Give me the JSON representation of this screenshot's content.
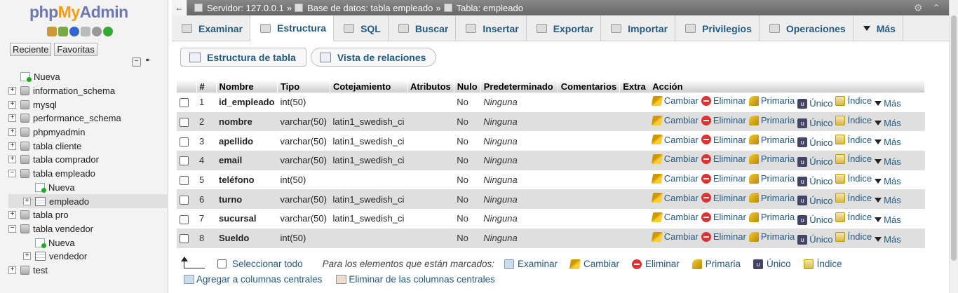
{
  "nav": {
    "logo_php": "php",
    "logo_my": "My",
    "logo_admin": "Admin",
    "tab_recent": "Reciente",
    "tab_favorites": "Favoritas",
    "tree": [
      {
        "label": "Nueva",
        "level": 0,
        "type": "new"
      },
      {
        "label": "information_schema",
        "level": 0,
        "type": "db"
      },
      {
        "label": "mysql",
        "level": 0,
        "type": "db"
      },
      {
        "label": "performance_schema",
        "level": 0,
        "type": "db"
      },
      {
        "label": "phpmyadmin",
        "level": 0,
        "type": "db"
      },
      {
        "label": "tabla cliente",
        "level": 0,
        "type": "db"
      },
      {
        "label": "tabla comprador",
        "level": 0,
        "type": "db"
      },
      {
        "label": "tabla empleado",
        "level": 0,
        "type": "db-open"
      },
      {
        "label": "Nueva",
        "level": 1,
        "type": "new"
      },
      {
        "label": "empleado",
        "level": 1,
        "type": "table"
      },
      {
        "label": "tabla pro",
        "level": 0,
        "type": "db"
      },
      {
        "label": "tabla vendedor",
        "level": 0,
        "type": "db-open"
      },
      {
        "label": "Nueva",
        "level": 1,
        "type": "new"
      },
      {
        "label": "vendedor",
        "level": 1,
        "type": "table"
      },
      {
        "label": "test",
        "level": 0,
        "type": "db"
      }
    ]
  },
  "breadcrumb": {
    "server": "Servidor: 127.0.0.1",
    "database": "Base de datos: tabla empleado",
    "table": "Tabla: empleado",
    "sep": "»"
  },
  "tabs": [
    {
      "label": "Examinar",
      "active": false
    },
    {
      "label": "Estructura",
      "active": true
    },
    {
      "label": "SQL",
      "active": false
    },
    {
      "label": "Buscar",
      "active": false
    },
    {
      "label": "Insertar",
      "active": false
    },
    {
      "label": "Exportar",
      "active": false
    },
    {
      "label": "Importar",
      "active": false
    },
    {
      "label": "Privilegios",
      "active": false
    },
    {
      "label": "Operaciones",
      "active": false
    },
    {
      "label": "Más",
      "active": false
    }
  ],
  "subbuttons": {
    "structure": "Estructura de tabla",
    "relations": "Vista de relaciones"
  },
  "table": {
    "headers": [
      "#",
      "Nombre",
      "Tipo",
      "Cotejamiento",
      "Atributos",
      "Nulo",
      "Predeterminado",
      "Comentarios",
      "Extra",
      "Acción"
    ],
    "rows": [
      {
        "num": "1",
        "name": "id_empleado",
        "type": "int(50)",
        "collation": "",
        "null": "No",
        "default": "Ninguna"
      },
      {
        "num": "2",
        "name": "nombre",
        "type": "varchar(50)",
        "collation": "latin1_swedish_ci",
        "null": "No",
        "default": "Ninguna"
      },
      {
        "num": "3",
        "name": "apellido",
        "type": "varchar(50)",
        "collation": "latin1_swedish_ci",
        "null": "No",
        "default": "Ninguna"
      },
      {
        "num": "4",
        "name": "email",
        "type": "varchar(50)",
        "collation": "latin1_swedish_ci",
        "null": "No",
        "default": "Ninguna"
      },
      {
        "num": "5",
        "name": "teléfono",
        "type": "int(50)",
        "collation": "",
        "null": "No",
        "default": "Ninguna"
      },
      {
        "num": "6",
        "name": "turno",
        "type": "varchar(50)",
        "collation": "latin1_swedish_ci",
        "null": "No",
        "default": "Ninguna"
      },
      {
        "num": "7",
        "name": "sucursal",
        "type": "varchar(50)",
        "collation": "latin1_swedish_ci",
        "null": "No",
        "default": "Ninguna"
      },
      {
        "num": "8",
        "name": "Sueldo",
        "type": "int(50)",
        "collation": "",
        "null": "No",
        "default": "Ninguna"
      }
    ],
    "actions": {
      "change": "Cambiar",
      "drop": "Eliminar",
      "primary": "Primaria",
      "unique": "Único",
      "index": "Índice",
      "more": "Más"
    }
  },
  "footer": {
    "select_all": "Seleccionar todo",
    "marked_label": "Para los elementos que están marcados:",
    "browse": "Examinar",
    "change": "Cambiar",
    "drop": "Eliminar",
    "primary": "Primaria",
    "unique": "Único",
    "index": "Índice",
    "add_central": "Agregar a columnas centrales",
    "remove_central": "Eliminar de las columnas centrales"
  }
}
